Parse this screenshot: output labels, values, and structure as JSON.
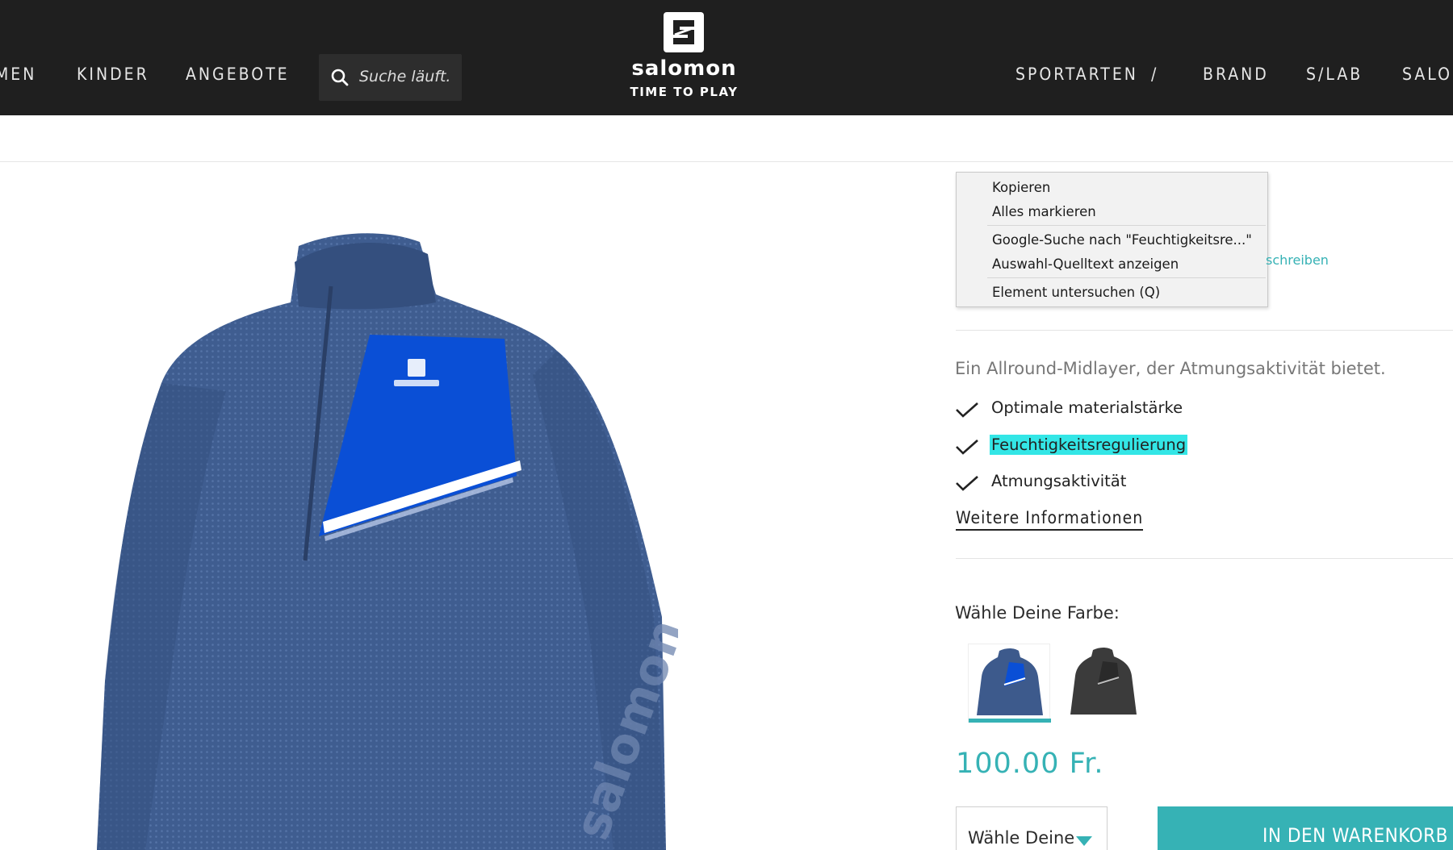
{
  "header": {
    "nav_left": [
      "MEN",
      "KINDER",
      "ANGEBOTE"
    ],
    "search_placeholder": "Suche läuft.",
    "logo_word": "salomon",
    "logo_tagline": "TIME TO PLAY",
    "nav_right": [
      "SPORTARTEN",
      "/",
      "BRAND",
      "S/LAB",
      "SALOM"
    ]
  },
  "context_menu": {
    "items": [
      "Kopieren",
      "Alles markieren",
      "Google-Suche nach \"Feuchtigkeitsre...\"",
      "Auswahl-Quelltext anzeigen",
      "Element untersuchen (Q)"
    ]
  },
  "rating_link": "schreiben",
  "product": {
    "description": "Ein Allround-Midlayer, der Atmungsaktivität bietet.",
    "features": [
      "Optimale materialstärke",
      "Feuchtigkeitsregulierung",
      "Atmungsaktivität"
    ],
    "highlighted_feature_index": 1,
    "more_info_label": "Weitere Informationen",
    "color_heading": "Wähle Deine Farbe:",
    "colors": [
      "navy-blue",
      "dark-grey"
    ],
    "selected_color_index": 0,
    "price": "100.00 Fr.",
    "size_select_label": "Wähle Deine",
    "cart_button_label": "IN DEN WARENKORB"
  },
  "colors": {
    "header_bg": "#1f1f1f",
    "accent": "#36b2b5",
    "highlight": "#33e6e6",
    "jacket_navy": "#3d5a8c",
    "jacket_blue_panel": "#0a4fd6"
  }
}
